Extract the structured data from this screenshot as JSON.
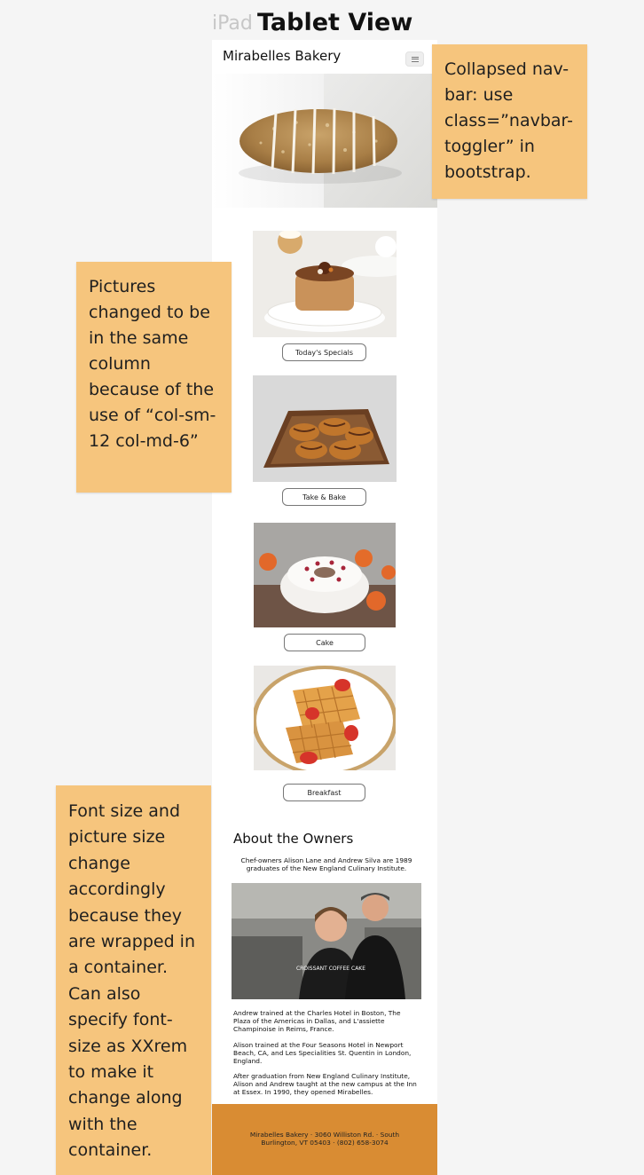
{
  "header": {
    "ipad_label": "iPad",
    "view_title": "Tablet View"
  },
  "navbar": {
    "brand": "Mirabelles Bakery",
    "toggler_icon": "hamburger-icon"
  },
  "cards": [
    {
      "label": "Today's Specials",
      "image": "tart-photo"
    },
    {
      "label": "Take & Bake",
      "image": "croissants-photo"
    },
    {
      "label": "Cake",
      "image": "bundt-cake-photo"
    },
    {
      "label": "Breakfast",
      "image": "waffles-photo"
    }
  ],
  "about": {
    "title": "About the Owners",
    "intro": "Chef-owners Alison Lane and Andrew Silva are 1989 graduates of the New England Culinary Institute.",
    "p1": "Andrew trained at the Charles Hotel in Boston, The Plaza of the Americas in Dallas, and L'assiette Champinoise in Reims, France.",
    "p2": "Alison trained at the Four Seasons Hotel in Newport Beach, CA, and Les Specialities St. Quentin in London, England.",
    "p3": "After graduation from New England Culinary Institute, Alison and Andrew taught at the new campus at the Inn at Essex. In 1990, they opened Mirabelles.",
    "shirt_text": "CROISSANT COFFEE CAKE"
  },
  "footer": {
    "text": "Mirabelles Bakery · 3060 Williston Rd. · South Burlington, VT 05403 · (802) 658-3074"
  },
  "notes": {
    "navbar": "Collapsed nav-bar: use class=”navbar-toggler” in bootstrap.",
    "pictures": "Pictures changed to be in the same column because of the use of “col-sm-12 col-md-6”",
    "font": "Font size and picture size change accordingly because they are wrapped in a container. Can also specify font-size as XXrem to make it change along with the container."
  },
  "colors": {
    "note": "#f6c57d",
    "footer": "#d98c33"
  }
}
